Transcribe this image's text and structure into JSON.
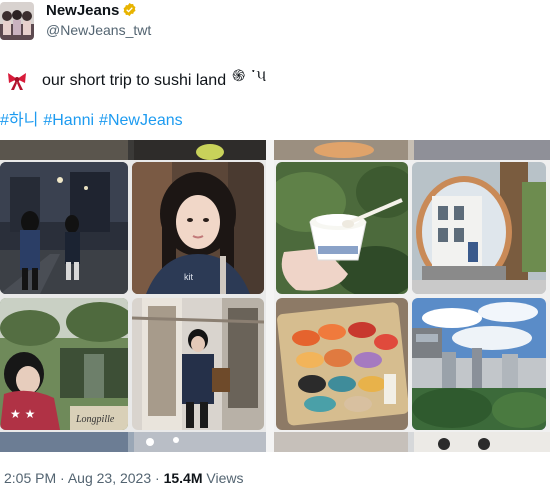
{
  "account": {
    "name": "NewJeans",
    "handle": "@NewJeans_twt",
    "verified_badge_color": "#e8b400"
  },
  "tweet": {
    "text": "our short trip to sushi land",
    "emoji_suffix": "֍ ་૫",
    "hashtags": [
      "#하니",
      "#Hanni",
      "#NewJeans"
    ]
  },
  "media": {
    "photos": [
      {
        "icon": "night-street-photo"
      },
      {
        "icon": "selfie-photo"
      },
      {
        "icon": "park-portrait-photo"
      },
      {
        "icon": "train-door-photo"
      },
      {
        "icon": "sushi-rice-cup-photo"
      },
      {
        "icon": "mirror-building-photo"
      },
      {
        "icon": "sushi-platter-photo"
      },
      {
        "icon": "city-skyline-photo"
      }
    ],
    "sign_text": "Longpille"
  },
  "footer": {
    "time": "2:05 PM",
    "separator": "·",
    "date": "Aug 23, 2023",
    "views_count": "15.4M",
    "views_label": "Views"
  },
  "colors": {
    "link": "#1d9bf0",
    "secondary_text": "#536471",
    "bow": "#d81b3a"
  }
}
